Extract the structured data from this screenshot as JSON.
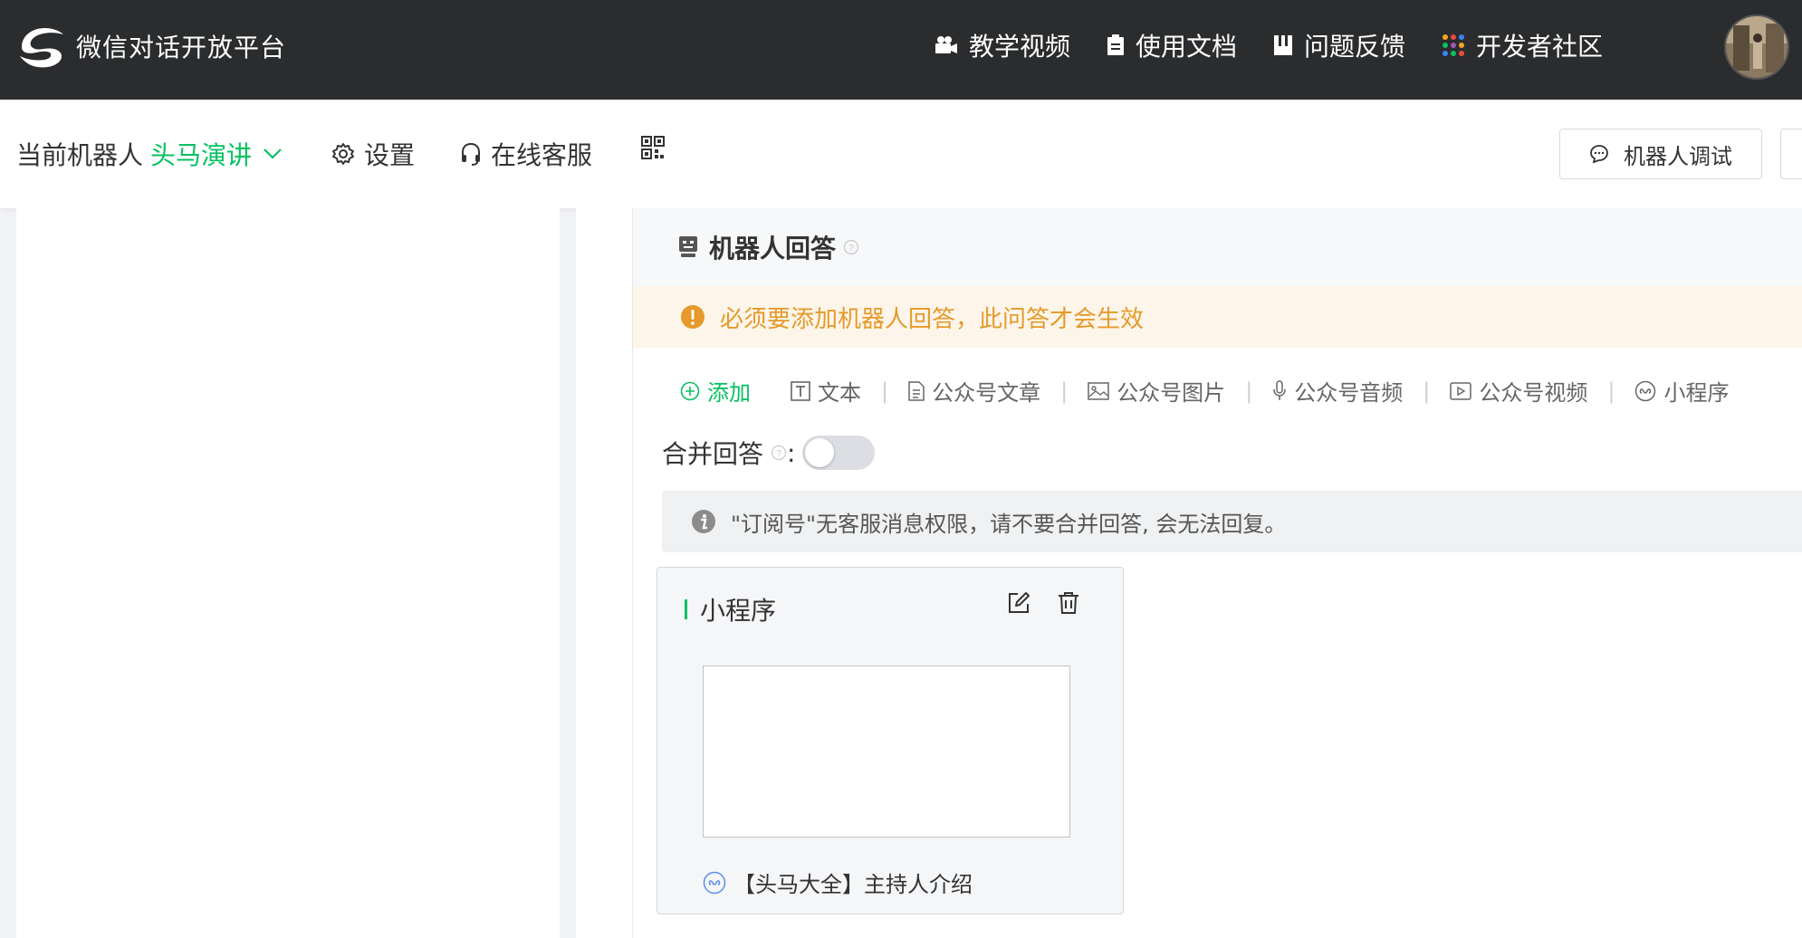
{
  "topbar": {
    "brand_name": "微信对话开放平台",
    "nav": [
      {
        "label": "教学视频",
        "icon": "video-camera-icon"
      },
      {
        "label": "使用文档",
        "icon": "document-icon"
      },
      {
        "label": "问题反馈",
        "icon": "feedback-icon"
      },
      {
        "label": "开发者社区",
        "icon": "community-grid-icon"
      }
    ]
  },
  "subbar": {
    "current_bot_label": "当前机器人",
    "current_bot_name": "头马演讲",
    "settings_label": "设置",
    "service_label": "在线客服",
    "debug_label": "机器人调试"
  },
  "section": {
    "title": "机器人回答",
    "warning": "必须要添加机器人回答，此问答才会生效"
  },
  "toolbar": {
    "add_label": "添加",
    "items": [
      "文本",
      "公众号文章",
      "公众号图片",
      "公众号音频",
      "公众号视频",
      "小程序"
    ]
  },
  "merge": {
    "label": "合并回答",
    "colon": ":",
    "enabled": false,
    "info": "\"订阅号\"无客服消息权限，请不要合并回答, 会无法回复。"
  },
  "card": {
    "title": "小程序",
    "program_name": "【头马大全】主持人介绍"
  },
  "colors": {
    "accent": "#07c160",
    "warning": "#e59a2b",
    "topbar": "#2b2c2e"
  }
}
